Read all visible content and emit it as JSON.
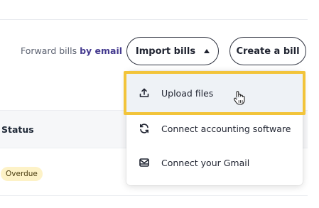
{
  "header": {
    "forward_prefix": "Forward bills",
    "forward_link": "by email",
    "import_label": "Import bills",
    "create_label": "Create a bill"
  },
  "table": {
    "status_header": "Status",
    "rows": [
      {
        "status": "Overdue"
      }
    ]
  },
  "import_menu": {
    "items": [
      {
        "label": "Upload files",
        "icon": "upload-icon",
        "highlighted": true
      },
      {
        "label": "Connect accounting software",
        "icon": "sync-icon"
      },
      {
        "label": "Connect your Gmail",
        "icon": "mail-icon"
      }
    ]
  },
  "colors": {
    "highlight_border": "#f2c43a",
    "badge_bg": "#fdf2c7",
    "link": "#443a8f"
  }
}
